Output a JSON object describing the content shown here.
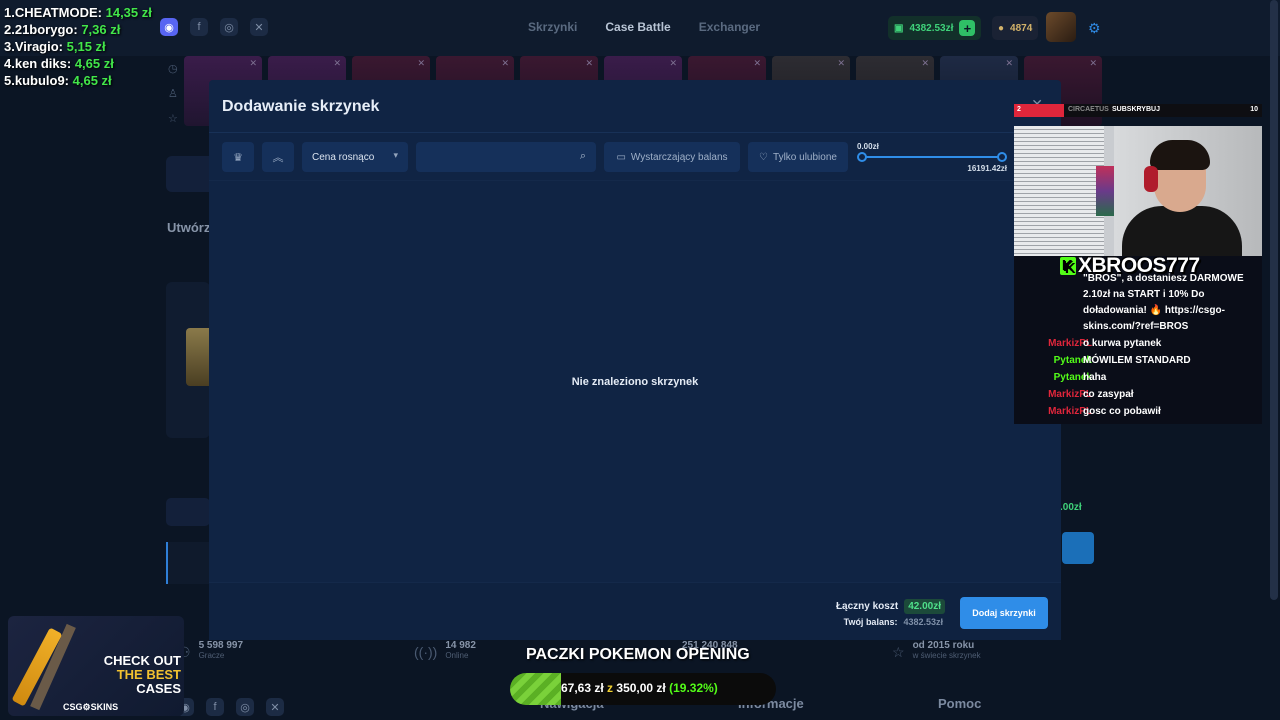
{
  "site": {
    "nav": [
      "Skrzynki",
      "Case Battle",
      "Exchanger"
    ],
    "wallet": "4382.53zł",
    "coins": "4874",
    "social": [
      "discord",
      "facebook",
      "instagram",
      "x"
    ],
    "left_title": "Utwórz",
    "footer_stats": [
      {
        "num": "5 598 997",
        "label": "Gracze"
      },
      {
        "num": "14 982",
        "label": "Online"
      },
      {
        "num": "251 240 848",
        "label": ""
      },
      {
        "num": "od 2015 roku",
        "label": "w świecie skrzynek"
      }
    ],
    "footer_links": [
      "Nawigacja",
      "Informacje",
      "Pomoc"
    ],
    "right_price": ".00zł"
  },
  "modal": {
    "title": "Dodawanie skrzynek",
    "sort_label": "Cena rosnąco",
    "search_placeholder": "",
    "balance_filter": "Wystarczający balans",
    "favorites_filter": "Tylko ulubione",
    "range_min": "0.00zł",
    "range_max": "16191.42zł",
    "empty_message": "Nie znaleziono skrzynek",
    "cost_label": "Łączny koszt",
    "cost_value": "42.00zł",
    "balance_label": "Twój balans:",
    "balance_value": "4382.53zł",
    "add_button": "Dodaj skrzynki"
  },
  "stream": {
    "leaderboard": [
      {
        "rank": "1.",
        "name": "CHEATMODE:",
        "amount": "14,35 zł"
      },
      {
        "rank": "2.",
        "name": "21borygo:",
        "amount": "7,36 zł"
      },
      {
        "rank": "3.",
        "name": "Viragio:",
        "amount": "5,15 zł"
      },
      {
        "rank": "4.",
        "name": "ken diks:",
        "amount": "4,65 zł"
      },
      {
        "rank": "5.",
        "name": "kubulo9:",
        "amount": "4,65 zł"
      }
    ],
    "sub_goal": {
      "current": "2",
      "name": "CIRCAETUS",
      "label": "SUBSKRYBUJ",
      "target": "10"
    },
    "channel": "XBROOS777",
    "chat_pinned": "\"BROS\", a dostaniesz DARMOWE 2.10zł na START i 10% Do doładowania! 🔥 https://csgo-skins.com/?ref=BROS",
    "chat": [
      {
        "user": "MarkizPL",
        "color": "red",
        "text": "o kurwa pytanek"
      },
      {
        "user": "Pytanek",
        "color": "green",
        "text": "MÓWILEM STANDARD"
      },
      {
        "user": "Pytanek",
        "color": "green",
        "text": "haha"
      },
      {
        "user": "MarkizPL",
        "color": "red",
        "text": "co zasypał"
      },
      {
        "user": "MarkizPL",
        "color": "red",
        "text": "gosc co pobawił"
      }
    ],
    "promo": {
      "line1": "CHECK OUT",
      "line2": "THE BEST",
      "line3": "CASES",
      "brand": "CSG⚙SKINS"
    },
    "goal": {
      "title": "PACZKI POKEMON OPENING",
      "current": "67,63 zł",
      "sep": "z",
      "target": "350,00 zł",
      "percent": "(19.32%)",
      "fraction": 0.1932
    }
  }
}
